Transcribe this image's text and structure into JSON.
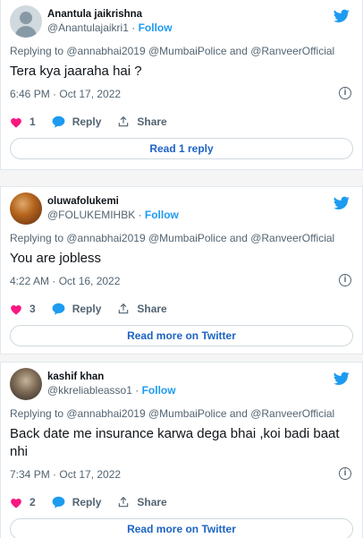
{
  "tweets": [
    {
      "display_name": "Anantula jaikrishna",
      "handle": "@Anantulajaikri1",
      "follow": "Follow",
      "replying_to": "Replying to @annabhai2019 @MumbaiPolice and @RanveerOfficial",
      "text": "Tera kya jaaraha hai ?",
      "timestamp": "6:46 PM · Oct 17, 2022",
      "likes": "1",
      "reply_label": "Reply",
      "share_label": "Share",
      "button_label": "Read 1 reply",
      "avatar": "default-avatar"
    },
    {
      "display_name": "oluwafolukemi",
      "handle": "@FOLUKEMIHBK",
      "follow": "Follow",
      "replying_to": "Replying to @annabhai2019 @MumbaiPolice and @RanveerOfficial",
      "text": "You are jobless",
      "timestamp": "4:22 AM · Oct 16, 2022",
      "likes": "3",
      "reply_label": "Reply",
      "share_label": "Share",
      "button_label": "Read more on Twitter",
      "avatar": "photo-avatar"
    },
    {
      "display_name": "kashif khan",
      "handle": "@kkreliableasso1",
      "follow": "Follow",
      "replying_to": "Replying to @annabhai2019 @MumbaiPolice and @RanveerOfficial",
      "text": "Back date me insurance karwa dega bhai ,koi badi baat nhi",
      "timestamp": "7:34 PM · Oct 17, 2022",
      "likes": "2",
      "reply_label": "Reply",
      "share_label": "Share",
      "button_label": "Read more on Twitter",
      "avatar": "photo-avatar"
    }
  ],
  "colors": {
    "twitter_blue": "#1d9bf0",
    "like_red": "#f91880",
    "link_blue": "#1d63c4",
    "muted": "#536471"
  },
  "icons": [
    "twitter-bird-icon",
    "heart-icon",
    "reply-bubble-icon",
    "share-icon",
    "info-icon"
  ]
}
